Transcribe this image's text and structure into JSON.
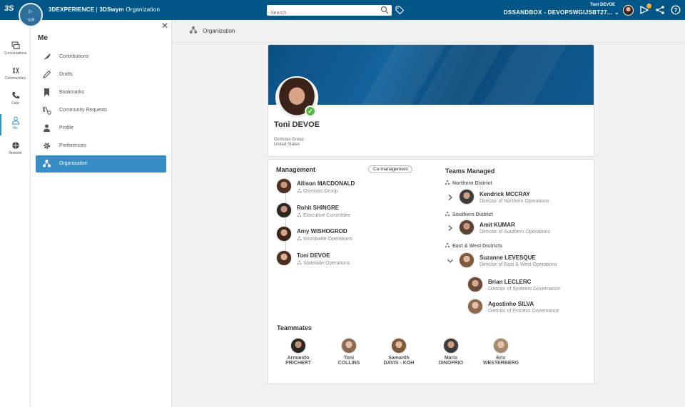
{
  "topbar": {
    "ds_logo": "3S",
    "compass_version": "V.R",
    "brand_bold": "3DEXPERIENCE",
    "brand_sep": " | ",
    "brand_app": "3DSwym",
    "brand_context": "Organization",
    "search_placeholder": "Search",
    "user_name": "Toni DEVOE",
    "tenant": "DSSANDBOX - DEVOPSWGIJSBT27...",
    "notification_count": "3"
  },
  "iconbar": {
    "items": [
      {
        "label": "Conversations",
        "icon": "conversations-icon"
      },
      {
        "label": "Communities",
        "icon": "communities-icon"
      },
      {
        "label": "Calls",
        "icon": "phone-icon"
      },
      {
        "label": "Me",
        "icon": "person-icon"
      },
      {
        "label": "Network",
        "icon": "network-icon"
      }
    ]
  },
  "me_panel": {
    "title": "Me",
    "items": [
      {
        "label": "Contributions",
        "icon": "feather-icon"
      },
      {
        "label": "Drafts",
        "icon": "pencil-icon"
      },
      {
        "label": "Bookmarks",
        "icon": "bookmark-icon"
      },
      {
        "label": "Community Requests",
        "icon": "community-request-icon"
      },
      {
        "label": "Profile",
        "icon": "profile-icon"
      },
      {
        "label": "Preferences",
        "icon": "gear-icon"
      },
      {
        "label": "Organization",
        "icon": "org-chart-icon"
      }
    ],
    "active": "Organization"
  },
  "page": {
    "title": "Organization"
  },
  "profile": {
    "name": "Toni DEVOE",
    "org_line1": "Osmosis Group",
    "org_line2": "United States"
  },
  "management": {
    "title": "Management",
    "badge": "Co-management",
    "people": [
      {
        "name": "Allison MACDONALD",
        "org": "Osmosis Group"
      },
      {
        "name": "Rohit SHINGRE",
        "org": "Executive Committee"
      },
      {
        "name": "Amy WISHOGROD",
        "org": "Worldwide Operations"
      },
      {
        "name": "Toni DEVOE",
        "org": "Stateside Operations"
      }
    ]
  },
  "teams": {
    "title": "Teams Managed",
    "districts": [
      {
        "name": "Northern District",
        "manager": "Kendrick MCCRAY",
        "role": "Director of Northern Operations"
      },
      {
        "name": "Southern District",
        "manager": "Amit KUMAR",
        "role": "Director of Southern Operations"
      },
      {
        "name": "East & West  Districts",
        "manager": "Suzanne LEVESQUE",
        "role": "Director of East & West Operations"
      }
    ],
    "reports": [
      {
        "name": "Brian LECLERC",
        "role": "Director of Systems Governance"
      },
      {
        "name": "Agostinho SILVA",
        "role": "Director of Process Governance"
      }
    ]
  },
  "teammates": {
    "title": "Teammates",
    "people": [
      {
        "first": "Armando",
        "last": "PRICHERT"
      },
      {
        "first": "Toni",
        "last": "COLLINS"
      },
      {
        "first": "Samanth",
        "last": "DAVIS - KOH"
      },
      {
        "first": "Maris",
        "last": "DINOFRIO"
      },
      {
        "first": "Eric",
        "last": "WESTERBERG"
      }
    ]
  },
  "colors": {
    "topbar": "#005686",
    "accent": "#368ec4",
    "verified": "#57b847"
  }
}
